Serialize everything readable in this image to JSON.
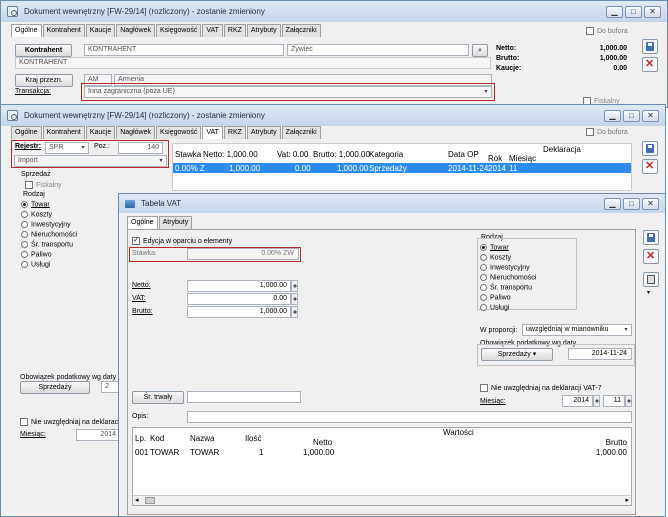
{
  "w1": {
    "title": "Dokument wewnętrzny [FW-29/14] (rozliczony) - zostanie zmieniony",
    "tabs": [
      "Ogólne",
      "Kontrahent",
      "Kaucje",
      "Nagłówek",
      "Księgowość",
      "VAT",
      "RKZ",
      "Atrybuty",
      "Załączniki"
    ],
    "do_bufora": "Do bufora",
    "kontrahent_btn": "Kontrahent",
    "kontrahent_code": "KONTRAHENT",
    "city": "Żywiec",
    "kontrahent_name": "KONTRAHENT",
    "kraj_btn": "Kraj przezn.",
    "kraj_code": "AM",
    "kraj_name": "Armenia",
    "transakcja_label": "Transakcja:",
    "transakcja_value": "Inna zagraniczna (poza UE)",
    "netto_l": "Netto:",
    "brutto_l": "Brutto:",
    "kaucje_l": "Kaucje:",
    "netto_v": "1,000.00",
    "brutto_v": "1,000.00",
    "kaucje_v": "0.00",
    "fiskalny": "Fiskalny"
  },
  "w2": {
    "title": "Dokument wewnętrzny [FW-29/14] (rozliczony) - zostanie zmieniony",
    "tabs": [
      "Ogólne",
      "Kontrahent",
      "Kaucje",
      "Nagłówek",
      "Księgowość",
      "VAT",
      "RKZ",
      "Atrybuty",
      "Załączniki"
    ],
    "do_bufora": "Do bufora",
    "rejestr_label": "Rejestr:",
    "rejestr_value": "SPR",
    "poz_label": "Poz.:",
    "poz_value": "140",
    "import": "Import",
    "sprzedaz": "Sprzedaż",
    "fiskalny": "Fiskalny",
    "rodzaj": "Rodzaj",
    "rodzaj_items": [
      "Towar",
      "Koszty",
      "Inwestycyjny",
      "Nieruchomości",
      "Śr. transportu",
      "Paliwo",
      "Usługi"
    ],
    "obowiazek": "Obowiązek podatkowy wg daty",
    "obowiazek_btn": "Sprzedaży",
    "obowiazek_val": "2",
    "nie_uwzgl": "Nie uwzględniaj na deklaracji",
    "miesiac": "Miesiąc:",
    "miesiac_val": "2014",
    "table_headers": [
      "Stawka",
      "Netto: 1,000.00",
      "Vat: 0.00",
      "Brutto: 1,000.00",
      "Kategoria",
      "Data OP",
      "Deklaracja",
      "Rok",
      "Miesiąc"
    ],
    "table_row": [
      "0.00% Z",
      "1,000.00",
      "0.00",
      "1,000.00",
      "Sprzedaży",
      "2014-11-24",
      "2014",
      "11"
    ]
  },
  "w3": {
    "title": "Tabela VAT",
    "tabs": [
      "Ogólne",
      "Atrybuty"
    ],
    "edycja": "Edycja w oparciu o elementy",
    "stawka_label": "Stawka:",
    "stawka_value": "0.00% ZW",
    "netto_label": "Netto:",
    "vat_label": "VAT:",
    "brutto_label": "Brutto:",
    "netto_value": "1,000.00",
    "vat_value": "0.00",
    "brutto_value": "1,000.00",
    "sr_trwaly": "Śr. trwały",
    "rodzaj": "Rodzaj",
    "rodzaj_items": [
      "Towar",
      "Koszty",
      "Inwestycyjny",
      "Nieruchomości",
      "Śr. transportu",
      "Paliwo",
      "Usługi"
    ],
    "w_proporcji": "W proporcji:",
    "w_proporcji_val": "uwzględniaj w mianowniku",
    "obowiazek": "Obowiązek podatkowy wg daty",
    "obowiazek_btn": "Sprzedaży",
    "obowiazek_date": "2014-11-24",
    "nie_uwzgl": "Nie uwzględniaj na deklaracji VAT-7",
    "miesiac": "Miesiąc:",
    "miesiac_year": "2014",
    "miesiac_month": "11",
    "opis": "Opis:",
    "cols": [
      "Lp.",
      "Kod",
      "Nazwa",
      "Ilość",
      "Wartości",
      "Netto",
      "Brutto"
    ],
    "row": [
      "001",
      "TOWAR",
      "TOWAR",
      "1",
      "1,000.00",
      "1,000.00"
    ]
  }
}
